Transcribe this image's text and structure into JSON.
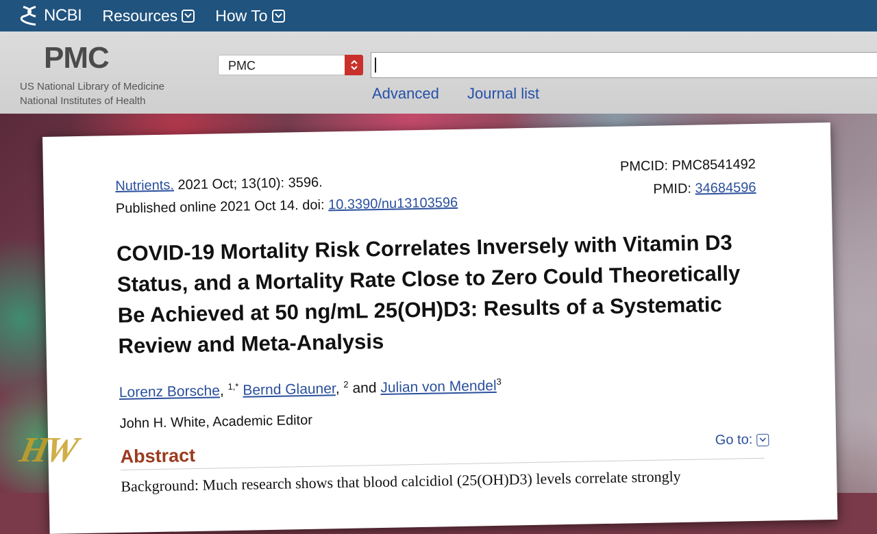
{
  "ncbi": {
    "logo_text": "NCBI",
    "nav": [
      {
        "label": "Resources"
      },
      {
        "label": "How To"
      }
    ]
  },
  "pmc": {
    "logo_text": "PMC",
    "subtitle_1": "US National Library of Medicine",
    "subtitle_2": "National Institutes of Health",
    "database_select": "PMC",
    "search_value": "",
    "links": {
      "advanced": "Advanced",
      "journal_list": "Journal list"
    }
  },
  "article": {
    "journal": "Nutrients.",
    "citation": " 2021 Oct; 13(10): 3596.",
    "published": "Published online 2021 Oct 14. doi: ",
    "doi": "10.3390/nu13103596",
    "pmcid_label": "PMCID: ",
    "pmcid": "PMC8541492",
    "pmid_label": "PMID: ",
    "pmid": "34684596",
    "title": "COVID-19 Mortality Risk Correlates Inversely with Vitamin D3 Status, and a Mortality Rate Close to Zero Could Theoretically Be Achieved at 50 ng/mL 25(OH)D3: Results of a Systematic Review and Meta-Analysis",
    "authors": [
      {
        "name": "Lorenz Borsche",
        "sup": "1,*"
      },
      {
        "name": "Bernd Glauner",
        "sup": "2"
      },
      {
        "name": "Julian von Mendel",
        "sup": "3"
      }
    ],
    "author_sep_1": ", ",
    "author_sep_2": " and ",
    "editor": "John H. White, Academic Editor",
    "abstract_heading": "Abstract",
    "goto_label": "Go to:",
    "abstract_text": "Background: Much research shows that blood calcidiol (25(OH)D3) levels correlate strongly"
  },
  "watermark": "HW",
  "colors": {
    "ncbi_bar": "#20537e",
    "link": "#2a4f9c",
    "abstract_heading": "#9a3b1f",
    "select_spinner": "#c9302c"
  }
}
